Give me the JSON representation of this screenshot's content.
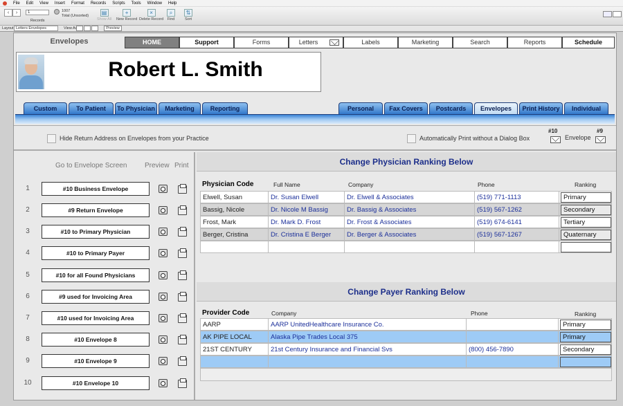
{
  "menubar": [
    "File",
    "Edit",
    "View",
    "Insert",
    "Format",
    "Records",
    "Scripts",
    "Tools",
    "Window",
    "Help"
  ],
  "toolbar": {
    "record_number": "1",
    "total_count": "1007",
    "total_label": "Total (Unsorted)",
    "records_label": "Records",
    "show_all": "Show All",
    "new_record": "New Record",
    "delete_record": "Delete Record",
    "find": "Find",
    "sort": "Sort"
  },
  "layoutbar": {
    "layout_label": "Layout:",
    "layout_value": "Letters Envelopes",
    "view_label": "View As:",
    "preview": "Preview"
  },
  "header": {
    "section_title": "Envelopes",
    "doctor_name": "Robert L. Smith"
  },
  "topnav": [
    "HOME",
    "Support",
    "Forms",
    "Letters",
    "Labels",
    "Marketing",
    "Search",
    "Reports",
    "Schedule"
  ],
  "left_tabs": [
    "Custom",
    "To Patient",
    "To Physician",
    "Marketing",
    "Reporting"
  ],
  "right_tabs": [
    "Personal",
    "Fax Covers",
    "Postcards",
    "Envelopes",
    "Print History",
    "Individual"
  ],
  "options": {
    "hide_return": "Hide Return Address on Envelopes from your Practice",
    "auto_print": "Automatically Print without a Dialog Box",
    "env10": "#10",
    "env9": "#9",
    "envelope": "Envelope"
  },
  "envelope_screen": {
    "heading": "Go to Envelope Screen",
    "preview": "Preview",
    "print": "Print",
    "items": [
      {
        "num": "1",
        "label": "#10 Business Envelope"
      },
      {
        "num": "2",
        "label": "#9 Return Envelope"
      },
      {
        "num": "3",
        "label": "#10 to Primary Physician"
      },
      {
        "num": "4",
        "label": "#10 to Primary Payer"
      },
      {
        "num": "5",
        "label": "#10 for all Found Physicians"
      },
      {
        "num": "6",
        "label": "#9 used for Invoicing Area"
      },
      {
        "num": "7",
        "label": "#10 used for Invoicing Area"
      },
      {
        "num": "8",
        "label": "#10 Envelope 8"
      },
      {
        "num": "9",
        "label": "#10 Envelope 9"
      },
      {
        "num": "10",
        "label": "#10 Envelope 10"
      }
    ]
  },
  "physician": {
    "title": "Change Physician Ranking Below",
    "columns": {
      "code": "Physician Code",
      "name": "Full Name",
      "company": "Company",
      "phone": "Phone",
      "ranking": "Ranking"
    },
    "rows": [
      {
        "code": "Elwell, Susan",
        "name": "Dr. Susan Elwell",
        "company": "Dr. Elwell & Associates",
        "phone": "(519) 771-1113",
        "rank": "Primary"
      },
      {
        "code": "Bassig, Nicole",
        "name": "Dr. Nicole M Bassig",
        "company": "Dr. Bassig & Associates",
        "phone": "(519) 567-1262",
        "rank": "Secondary"
      },
      {
        "code": "Frost, Mark",
        "name": "Dr. Mark D. Frost",
        "company": "Dr. Frost & Associates",
        "phone": "(519) 674-6141",
        "rank": "Tertiary"
      },
      {
        "code": "Berger, Cristina",
        "name": "Dr. Cristina E Berger",
        "company": "Dr. Berger & Associates",
        "phone": "(519) 567-1267",
        "rank": "Quaternary"
      }
    ]
  },
  "payer": {
    "title": "Change Payer Ranking Below",
    "columns": {
      "code": "Provider Code",
      "company": "Company",
      "phone": "Phone",
      "ranking": "Ranking"
    },
    "rows": [
      {
        "code": "AARP",
        "company": "AARP UnitedHealthcare Insurance Co.",
        "phone": "",
        "rank": "Primary"
      },
      {
        "code": "AK PIPE LOCAL",
        "company": "Alaska Pipe Trades Local 375",
        "phone": "",
        "rank": "Primary"
      },
      {
        "code": "21ST CENTURY",
        "company": "21st Century Insurance and Financial Svs",
        "phone": "(800) 456-7890",
        "rank": "Secondary"
      }
    ]
  },
  "colors": {
    "tab_blue": "#2c73c8",
    "header_text": "#1c2e8a",
    "highlight_row": "#9ecbf6"
  }
}
